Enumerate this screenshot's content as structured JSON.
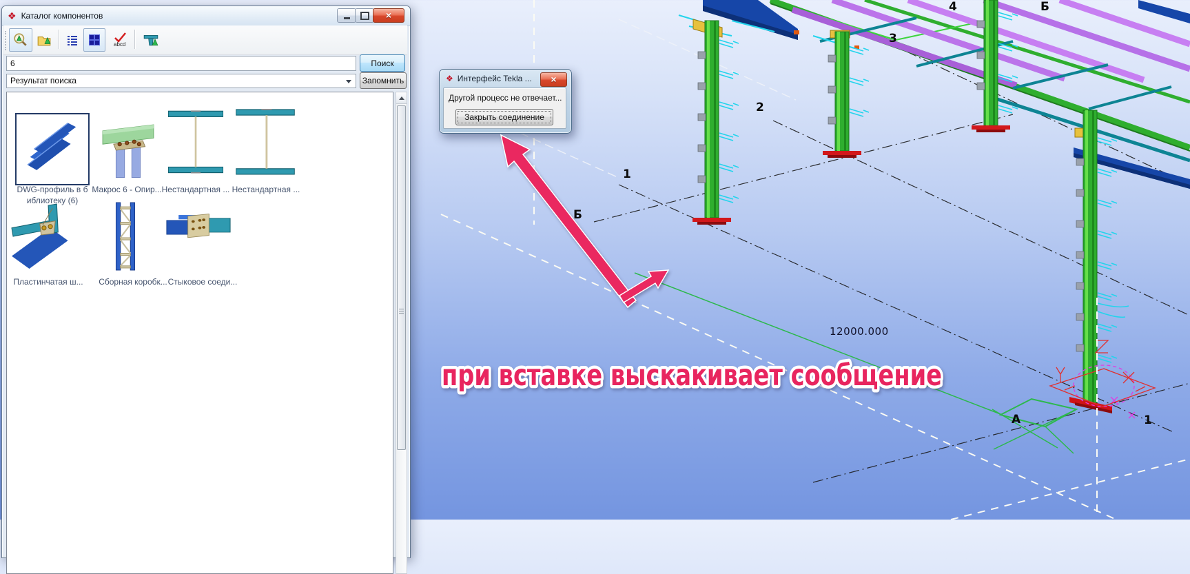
{
  "catalog_window": {
    "title": "Каталог компонентов",
    "search_value": "6",
    "search_button": "Поиск",
    "filter_value": "Результат поиска",
    "remember_button": "Запомнить",
    "toolbar": {
      "abcd_label": "abcd"
    },
    "items": [
      {
        "line1": "DWG-профиль в б",
        "line2": "иблиотеку (6)"
      },
      {
        "line1": "Макрос 6 - Опир..."
      },
      {
        "line1": "Нестандартная ..."
      },
      {
        "line1": "Нестандартная ..."
      },
      {
        "line1": "Пластинчатая ш..."
      },
      {
        "line1": "Сборная коробк..."
      },
      {
        "line1": "Стыковое соеди..."
      }
    ]
  },
  "tekla_dialog": {
    "title": "Интерфейс Tekla ...",
    "message": "Другой процесс не отвечает...",
    "close_button": "Закрыть соединение"
  },
  "annotation": {
    "text": "при вставке выскакивает сообщение",
    "color": "#e8255f"
  },
  "model_view": {
    "dimension_label": "12000.000",
    "grid_labels": [
      {
        "text": "1"
      },
      {
        "text": "2"
      },
      {
        "text": "3"
      },
      {
        "text": "4"
      },
      {
        "text": "Б"
      },
      {
        "text": "Б"
      },
      {
        "text": "А"
      },
      {
        "text": "1"
      }
    ],
    "colors": {
      "column_green": "#2fae2f",
      "purlin_purple": "#b671e8",
      "beam_blue": "#1646a8",
      "brace_teal": "#0d8494",
      "bracket_cyan": "#22d4ec",
      "base_red": "#d01215",
      "annotation_pink": "#ea2860"
    }
  }
}
